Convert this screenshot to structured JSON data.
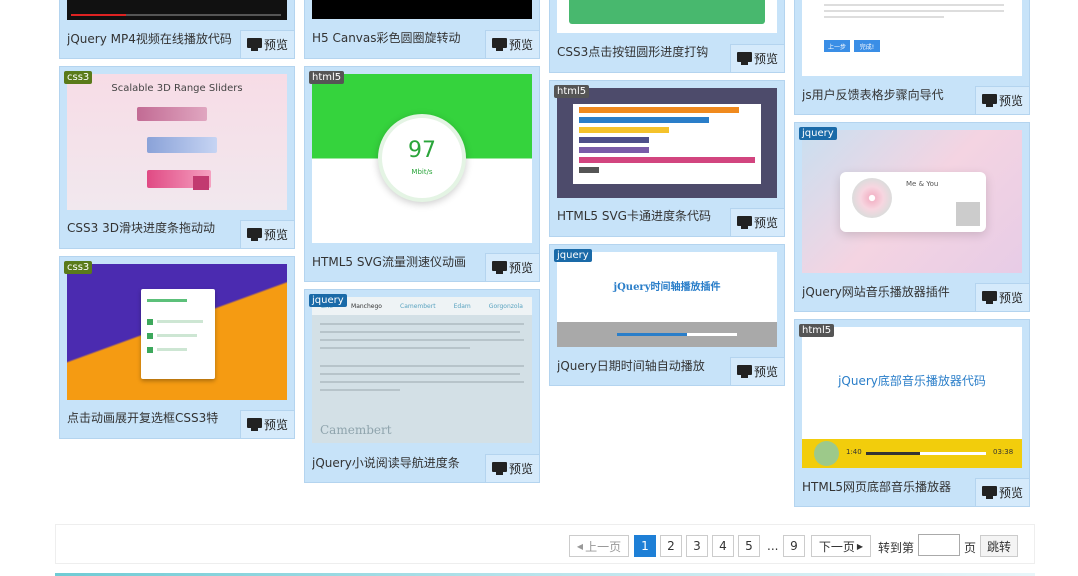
{
  "preview_label": "预览",
  "cards": {
    "c1_1": {
      "title": "jQuery MP4视频在线播放代码"
    },
    "c1_2": {
      "title": "CSS3 3D滑块进度条拖动动",
      "tag": "css3",
      "thumb_heading": "Scalable 3D Range Sliders"
    },
    "c1_3": {
      "title": "点击动画展开复选框CSS3特",
      "tag": "css3"
    },
    "c2_1": {
      "title": "H5 Canvas彩色圆圈旋转动"
    },
    "c2_2": {
      "title": "HTML5 SVG流量测速仪动画",
      "tag": "html5",
      "speed_value": "97",
      "speed_unit": "Mbit/s"
    },
    "c2_3": {
      "title": "jQuery小说阅读导航进度条",
      "tag": "jquery",
      "nav_items": [
        "Brie",
        "Manchego",
        "Camembert",
        "Edam",
        "Gorgonzola"
      ],
      "thumb_heading": "Camembert"
    },
    "c3_1": {
      "title": "CSS3点击按钮圆形进度打钩"
    },
    "c3_2": {
      "title": "HTML5 SVG卡通进度条代码",
      "tag": "html5"
    },
    "c3_3": {
      "title": "jQuery日期时间轴自动播放",
      "tag": "jquery",
      "thumb_heading": "jQuery时间轴播放插件"
    },
    "c4_1": {
      "title": "js用户反馈表格步骤向导代",
      "buttons": [
        "上一步",
        "完成!"
      ]
    },
    "c4_2": {
      "title": "jQuery网站音乐播放器插件",
      "tag": "jquery",
      "song": "Me & You"
    },
    "c4_3": {
      "title": "HTML5网页底部音乐播放器",
      "tag": "html5",
      "thumb_heading": "jQuery底部音乐播放器代码",
      "time_start": "1:40",
      "time_end": "03:38"
    }
  },
  "pagination": {
    "prev": "上一页",
    "pages": [
      "1",
      "2",
      "3",
      "4",
      "5"
    ],
    "ellipsis": "...",
    "last": "9",
    "next": "下一页",
    "goto_label": "转到第",
    "page_unit": "页",
    "jump": "跳转"
  },
  "colors": {
    "card_bg": "#c7e3f9",
    "active_page": "#1e7fd6"
  }
}
